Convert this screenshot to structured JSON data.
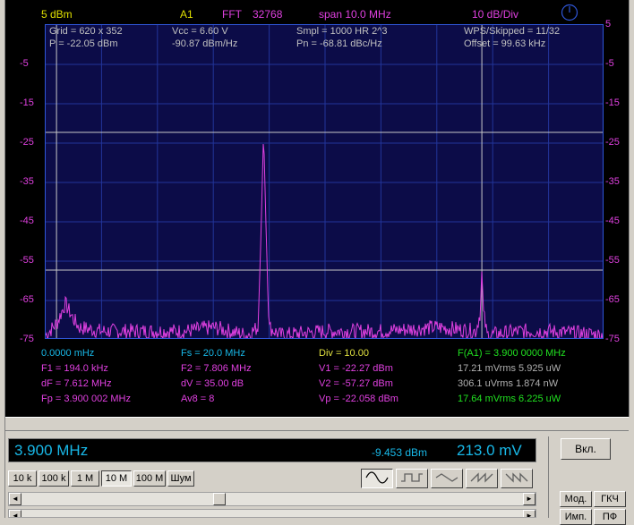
{
  "header": {
    "ref_level": "5 dBm",
    "channel": "A1",
    "fft_label": "FFT",
    "fft_size": "32768",
    "span": "span 10.0 MHz",
    "div": "10 dB/Div",
    "icon": "power-icon"
  },
  "info": {
    "grid": "Grid = 620 x 352",
    "p": "P = -22.05 dBm",
    "vcc": "Vcc = 6.60 V",
    "dbmhz": "-90.87 dBm/Hz",
    "smpl": "Smpl = 1000 HR 2^3",
    "pn": "Pn = -68.81 dBc/Hz",
    "wps": "WPS/Skipped = 11/32",
    "offset": "Offset = 99.63 kHz"
  },
  "y_labels_left": [
    "-5",
    "-15",
    "-25",
    "-35",
    "-45",
    "-55",
    "-65",
    "-75"
  ],
  "y_labels_right": [
    "5",
    "-5",
    "-15",
    "-25",
    "-35",
    "-45",
    "-55",
    "-65",
    "-75"
  ],
  "readouts": {
    "r1": [
      "0.0000 mHz",
      "Fs = 20.0 MHz",
      "Div = 10.00",
      "F(A1) = 3.900 0000 MHz"
    ],
    "r2": [
      "F1 = 194.0 kHz",
      "F2 = 7.806 MHz",
      "V1 = -22.27 dBm",
      "17.21 mVrms  5.925 uW"
    ],
    "r3": [
      "dF = 7.612 MHz",
      "dV = 35.00 dB",
      "V2 = -57.27 dBm",
      "306.1 uVrms  1.874 nW"
    ],
    "r4": [
      "Fp = 3.900 002 MHz",
      "Av8 = 8",
      "Vp = -22.058 dBm",
      "17.64 mVrms  6.225 uW"
    ]
  },
  "generator": {
    "freq": "3.900 MHz",
    "level_dbm": "-9.453 dBm",
    "voltage": "213.0 mV",
    "enable_button": "Вкл.",
    "range_buttons": [
      "10 k",
      "100 k",
      "1 M",
      "10 M",
      "100 M",
      "Шум"
    ],
    "selected_range": "10 M",
    "waveforms": [
      "sine-wave-icon",
      "square-wave-icon",
      "triangle-wave-icon",
      "sawtooth-up-icon",
      "sawtooth-down-icon"
    ],
    "selected_waveform": "sine-wave-icon",
    "mod_button": "Мод.",
    "gkch_button": "ГКЧ",
    "imp_button": "Имп.",
    "pf_button": "ПФ"
  },
  "chart_data": {
    "type": "line",
    "xlim": [
      0,
      10
    ],
    "x_unit": "MHz",
    "ylim": [
      -75,
      5
    ],
    "y_unit": "dBm",
    "grid": "on",
    "series": [
      {
        "x": [
          0.0,
          0.2,
          0.35,
          0.5,
          0.6,
          1.0,
          1.5,
          2.0,
          2.5,
          3.0,
          3.6,
          3.8,
          3.85,
          3.9,
          3.95,
          4.0,
          4.2,
          5.0,
          6.0,
          7.0,
          7.7,
          7.78,
          7.806,
          7.83,
          7.9,
          8.5,
          9.0,
          10.0
        ],
        "y": [
          -74,
          -71,
          -66,
          -70,
          -72,
          -73,
          -73,
          -73,
          -73,
          -72,
          -74,
          -72,
          -50,
          -22,
          -50,
          -72,
          -74,
          -73,
          -73,
          -72,
          -73,
          -68,
          -57,
          -68,
          -74,
          -73,
          -73,
          -74
        ]
      }
    ],
    "markers": {
      "f1_mhz": 0.194,
      "f2_mhz": 7.806,
      "v1_dbm": -22.27,
      "v2_dbm": -57.27
    }
  }
}
